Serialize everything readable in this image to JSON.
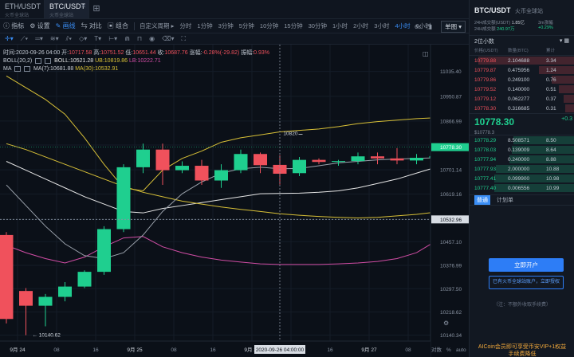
{
  "tabs": [
    {
      "symbol": "ETH/USDT",
      "exchange": "火币全球站",
      "active": false
    },
    {
      "symbol": "BTC/USDT",
      "exchange": "火币全球站",
      "active": true
    }
  ],
  "toolbar": {
    "tools": [
      "指标",
      "设置",
      "画线",
      "对比",
      "组合"
    ],
    "active_tool": "画线",
    "period_custom": "自定义周期",
    "periods": [
      "分时",
      "1分钟",
      "3分钟",
      "5分钟",
      "10分钟",
      "15分钟",
      "30分钟",
      "1小时",
      "2小时",
      "3小时",
      "4小时",
      "6小时"
    ],
    "active_period": "4小时",
    "speed": "6s",
    "chart_type": "单图"
  },
  "legend": {
    "time": "时间:2020-09-26 04:00",
    "open_label": "开:",
    "open": "10717.58",
    "high_label": "高:",
    "high": "10751.52",
    "low_label": "低:",
    "low": "10651.44",
    "close_label": "收:",
    "close": "10687.76",
    "change_label": "涨幅:",
    "change": "-0.28%(-29.82)",
    "amp_label": "振幅:",
    "amp": "0.93%",
    "boll_name": "BOLL(20,2)",
    "boll_label": "BOLL:",
    "boll": "10521.28",
    "ub_label": "UB:",
    "ub": "10819.86",
    "lb_label": "LB:",
    "lb": "10222.71",
    "ma_name": "MA",
    "ma7_label": "MA(7):",
    "ma7": "10681.88",
    "ma30_label": "MA(30):",
    "ma30": "10532.91"
  },
  "chart_data": {
    "type": "candlestick",
    "ylim": [
      10120,
      11110
    ],
    "y_ticks": [
      11035.4,
      10950.87,
      10866.99,
      10785.4,
      10701.14,
      10619.16,
      10532.96,
      10457.1,
      10376.99,
      10297.5,
      10218.62,
      10140.34
    ],
    "x_labels": [
      "9月 24",
      "08",
      "16",
      "9月 25",
      "08",
      "16",
      "9月 26",
      "08",
      "16",
      "9月 27",
      "08"
    ],
    "crosshair_time": "2020-09-26 04:00:00",
    "crosshair_price": "10532.96",
    "current_price": "10778.30",
    "annotations": [
      {
        "label": "10820"
      },
      {
        "label": "10140.62"
      }
    ],
    "candles": [
      [
        10480,
        10490,
        10180,
        10195
      ],
      [
        10290,
        10300,
        10140,
        10240
      ],
      [
        10240,
        10280,
        10170,
        10270
      ],
      [
        10270,
        10320,
        10255,
        10305
      ],
      [
        10305,
        10360,
        10300,
        10355
      ],
      [
        10355,
        10510,
        10345,
        10500
      ],
      [
        10500,
        10720,
        10490,
        10710
      ],
      [
        10710,
        10790,
        10690,
        10770
      ],
      [
        10770,
        10790,
        10650,
        10700
      ],
      [
        10700,
        10730,
        10690,
        10715
      ],
      [
        10715,
        10735,
        10650,
        10665
      ],
      [
        10665,
        10720,
        10640,
        10700
      ],
      [
        10700,
        10770,
        10690,
        10755
      ],
      [
        10755,
        10760,
        10690,
        10717
      ],
      [
        10718,
        10751,
        10651,
        10688
      ],
      [
        10690,
        10745,
        10680,
        10735
      ],
      [
        10735,
        10740,
        10720,
        10728
      ],
      [
        10728,
        10735,
        10715,
        10731
      ],
      [
        10731,
        10760,
        10720,
        10747
      ],
      [
        10747,
        10760,
        10720,
        10740
      ],
      [
        10740,
        10775,
        10720,
        10733
      ],
      [
        10733,
        10755,
        10720,
        10742
      ],
      [
        10742,
        10760,
        10735,
        10748
      ],
      [
        10745,
        10800,
        10740,
        10788
      ]
    ],
    "series": [
      {
        "name": "UB",
        "color": "#d8c037",
        "values": [
          11020,
          10980,
          10940,
          10890,
          10810,
          10720,
          10640,
          10630,
          10700,
          10740,
          10765,
          10795,
          10810,
          10820,
          10830,
          10835,
          10840,
          10848,
          10858,
          10865,
          10870,
          10875,
          10878,
          10880
        ]
      },
      {
        "name": "BOLL",
        "color": "#e6e6e6",
        "values": [
          10730,
          10700,
          10670,
          10640,
          10610,
          10585,
          10560,
          10555,
          10570,
          10580,
          10590,
          10600,
          10610,
          10620,
          10621,
          10622,
          10625,
          10630,
          10640,
          10655,
          10670,
          10690,
          10710,
          10735
        ]
      },
      {
        "name": "LB",
        "color": "#d14da5",
        "values": [
          10445,
          10420,
          10400,
          10385,
          10405,
          10440,
          10470,
          10475,
          10440,
          10420,
          10405,
          10395,
          10388,
          10382,
          10380,
          10380,
          10380,
          10382,
          10385,
          10390,
          10400,
          10420,
          10460,
          10505
        ]
      },
      {
        "name": "MA(30)",
        "color": "#d8c037",
        "values": [
          10790,
          10770,
          10745,
          10720,
          10695,
          10670,
          10645,
          10625,
          10610,
          10595,
          10585,
          10575,
          10567,
          10560,
          10552,
          10547,
          10543,
          10540,
          10538,
          10540,
          10545,
          10550,
          10558,
          10570
        ]
      },
      {
        "name": "MA(7)",
        "color": "#9aa1ab",
        "values": [
          10650,
          10580,
          10510,
          10450,
          10410,
          10400,
          10420,
          10480,
          10560,
          10620,
          10660,
          10690,
          10705,
          10710,
          10705,
          10706,
          10715,
          10725,
          10730,
          10735,
          10738,
          10740,
          10742,
          10748
        ]
      }
    ]
  },
  "panel": {
    "title": "BTC/USDT",
    "subtitle": "火币全球站",
    "stats": {
      "line1": "24H成交额(USDT)",
      "vol": "1.85亿",
      "line2": "24H成交额",
      "amount": "240.97万",
      "right1": "3m涨幅",
      "right2": "+0.29%"
    },
    "depth": "2位小数",
    "order_headers": [
      "价格(USDT)",
      "数量(BTC)",
      "累计"
    ],
    "asks": [
      {
        "price": "10779.88",
        "amount": "2.104688",
        "total": "3.34",
        "bar": 0.95
      },
      {
        "price": "10779.87",
        "amount": "0.475956",
        "total": "1.24",
        "bar": 0.35
      },
      {
        "price": "10779.86",
        "amount": "0.249100",
        "total": "0.76",
        "bar": 0.22
      },
      {
        "price": "10779.52",
        "amount": "0.140000",
        "total": "0.51",
        "bar": 0.15
      },
      {
        "price": "10779.12",
        "amount": "0.062277",
        "total": "0.37",
        "bar": 0.1
      },
      {
        "price": "10778.30",
        "amount": "0.316685",
        "total": "0.31",
        "bar": 0.09
      }
    ],
    "last_price": "10778.30",
    "last_sub": "$10778.3",
    "last_change": "+0.3",
    "bids": [
      {
        "price": "10778.29",
        "amount": "8.508571",
        "total": "8.50",
        "bar": 0.6
      },
      {
        "price": "10778.03",
        "amount": "0.139009",
        "total": "8.64",
        "bar": 0.62
      },
      {
        "price": "10777.94",
        "amount": "0.240000",
        "total": "8.88",
        "bar": 0.64
      },
      {
        "price": "10777.93",
        "amount": "2.000000",
        "total": "10.88",
        "bar": 0.78
      },
      {
        "price": "10777.41",
        "amount": "0.099900",
        "total": "10.98",
        "bar": 0.79
      },
      {
        "price": "10777.40",
        "amount": "0.006556",
        "total": "10.99",
        "bar": 0.79
      }
    ],
    "tab_normal": "普通",
    "tab_plan": "计划单",
    "open_button": "立即开户",
    "auth_button": "已有火币全球站账户，立即授权",
    "note": "（注：不额外收取手续费）",
    "promo": "AICoin会员即可享受币安VIP+1权益",
    "promo2": "手续费降低"
  }
}
